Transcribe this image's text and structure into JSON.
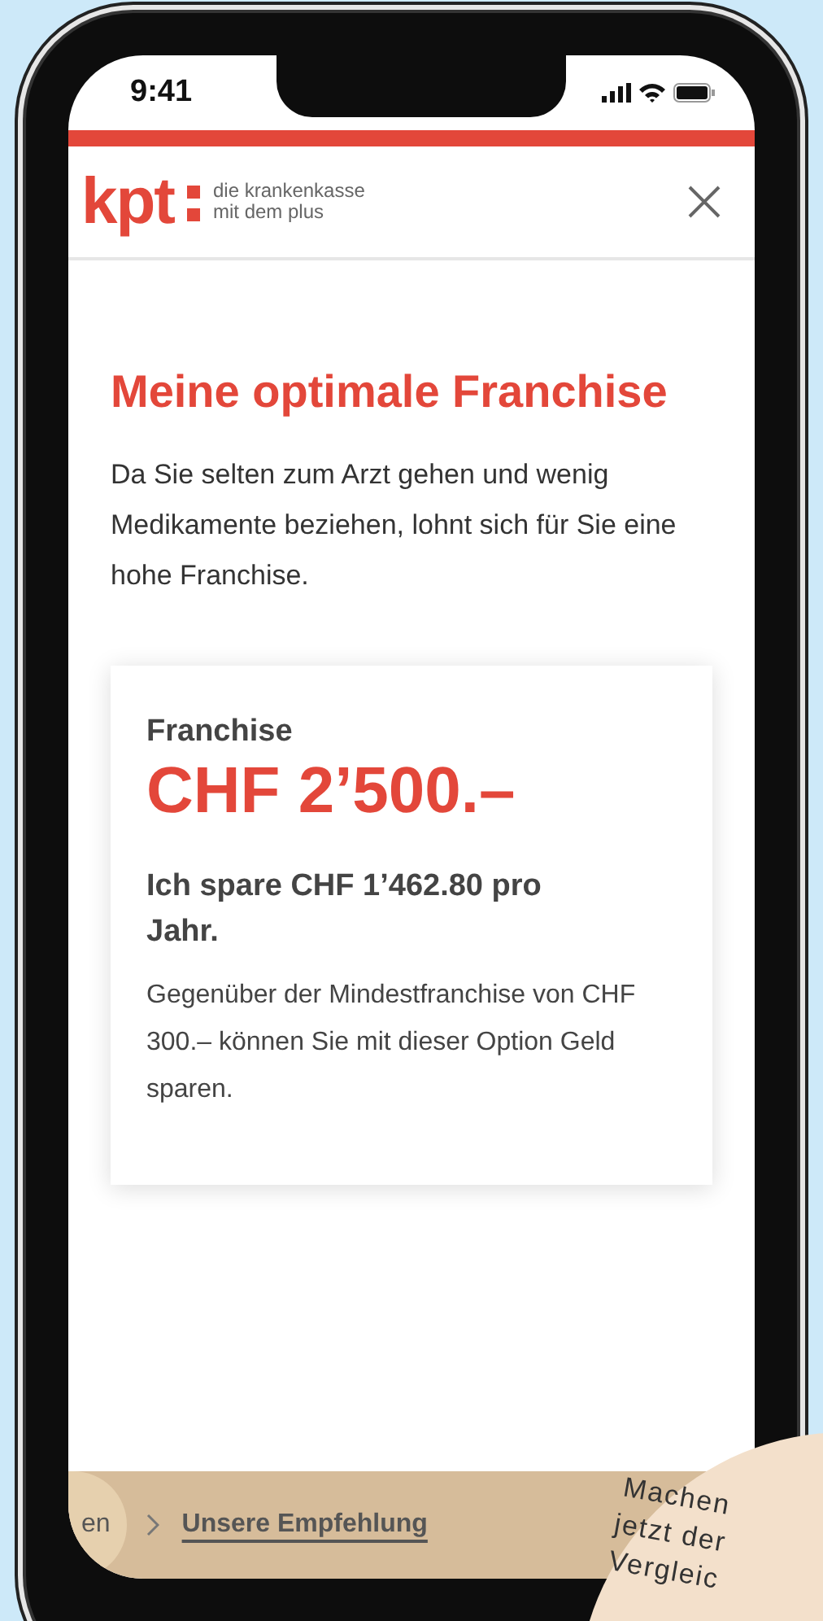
{
  "status_bar": {
    "time": "9:41"
  },
  "header": {
    "logo": "kpt",
    "tagline": [
      "die krankenkasse",
      "mit dem plus"
    ]
  },
  "title": "Meine optimale Franchise",
  "intro": "Da Sie selten zum Arzt gehen und wenig Medikamente beziehen, lohnt sich für Sie eine hohe Franchise.",
  "card": {
    "label": "Franchise",
    "amount": "CHF 2’500.–",
    "savings": "Ich spare CHF 1’462.80 pro Jahr.",
    "note": "Gegenüber der Mindestfranchise von CHF 300.– können Sie mit dieser Option Geld sparen."
  },
  "breadcrumb": [
    {
      "label": "en",
      "selected": false
    },
    {
      "label": "Unsere Empfehlung",
      "selected": true
    }
  ],
  "badge": {
    "lines": [
      "Machen",
      "jetzt der",
      "Vergleic"
    ]
  }
}
